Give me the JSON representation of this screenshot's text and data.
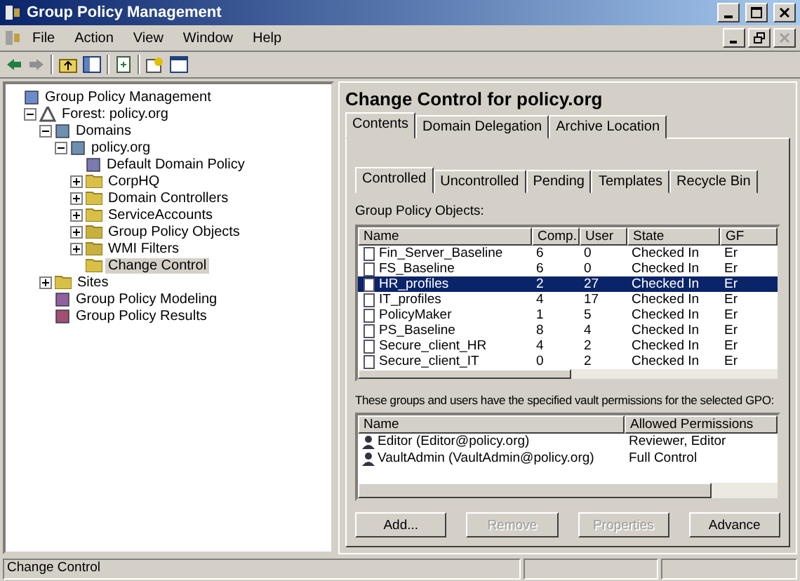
{
  "window": {
    "title": "Group Policy Management"
  },
  "menu": [
    "File",
    "Action",
    "View",
    "Window",
    "Help"
  ],
  "tree": [
    {
      "label": "Group Policy Management",
      "kind": "console",
      "selected": false,
      "children": [
        {
          "label": "Forest: policy.org",
          "kind": "forest",
          "expanded": true,
          "selected": false,
          "children": [
            {
              "label": "Domains",
              "kind": "domains",
              "expanded": true,
              "selected": false,
              "children": [
                {
                  "label": "policy.org",
                  "kind": "domain",
                  "expanded": true,
                  "selected": false,
                  "children": [
                    {
                      "label": "Default Domain Policy",
                      "kind": "gpo",
                      "selected": false
                    },
                    {
                      "label": "CorpHQ",
                      "kind": "ou",
                      "expanded": false,
                      "selected": false
                    },
                    {
                      "label": "Domain Controllers",
                      "kind": "ou",
                      "expanded": false,
                      "selected": false
                    },
                    {
                      "label": "ServiceAccounts",
                      "kind": "ou",
                      "expanded": false,
                      "selected": false
                    },
                    {
                      "label": "Group Policy Objects",
                      "kind": "container",
                      "expanded": false,
                      "selected": false
                    },
                    {
                      "label": "WMI Filters",
                      "kind": "container",
                      "expanded": false,
                      "selected": false
                    },
                    {
                      "label": "Change Control",
                      "kind": "ou",
                      "selected": true
                    }
                  ]
                }
              ]
            },
            {
              "label": "Sites",
              "kind": "ou",
              "expanded": false,
              "selected": false
            },
            {
              "label": "Group Policy Modeling",
              "kind": "modeling",
              "selected": false
            },
            {
              "label": "Group Policy Results",
              "kind": "results",
              "selected": false
            }
          ]
        }
      ]
    }
  ],
  "panel": {
    "title": "Change Control for policy.org",
    "tabs": [
      {
        "label": "Contents",
        "selected": true
      },
      {
        "label": "Domain Delegation",
        "selected": false
      },
      {
        "label": "Archive Location",
        "selected": false
      }
    ],
    "subtabs": [
      {
        "label": "Controlled",
        "selected": true
      },
      {
        "label": "Uncontrolled",
        "selected": false
      },
      {
        "label": "Pending",
        "selected": false
      },
      {
        "label": "Templates",
        "selected": false
      },
      {
        "label": "Recycle Bin",
        "selected": false
      }
    ],
    "gpo_label": "Group Policy Objects:",
    "gpo_table": {
      "columns": [
        "Name",
        "Comp.",
        "User",
        "State",
        "GF"
      ],
      "rows": [
        {
          "cells": [
            "Fin_Server_Baseline",
            "6",
            "0",
            "Checked In",
            "Er"
          ],
          "selected": false
        },
        {
          "cells": [
            "FS_Baseline",
            "6",
            "0",
            "Checked In",
            "Er"
          ],
          "selected": false
        },
        {
          "cells": [
            "HR_profiles",
            "2",
            "27",
            "Checked In",
            "Er"
          ],
          "selected": true
        },
        {
          "cells": [
            "IT_profiles",
            "4",
            "17",
            "Checked In",
            "Er"
          ],
          "selected": false
        },
        {
          "cells": [
            "PolicyMaker",
            "1",
            "5",
            "Checked In",
            "Er"
          ],
          "selected": false
        },
        {
          "cells": [
            "PS_Baseline",
            "8",
            "4",
            "Checked In",
            "Er"
          ],
          "selected": false
        },
        {
          "cells": [
            "Secure_client_HR",
            "4",
            "2",
            "Checked In",
            "Er"
          ],
          "selected": false
        },
        {
          "cells": [
            "Secure_client_IT",
            "0",
            "2",
            "Checked In",
            "Er"
          ],
          "selected": false
        }
      ]
    },
    "perm_label": "These groups and users have the specified vault permissions for the selected GPO:",
    "perm_table": {
      "columns": [
        "Name",
        "Allowed Permissions"
      ],
      "rows": [
        {
          "cells": [
            "Editor (Editor@policy.org)",
            "Reviewer, Editor"
          ]
        },
        {
          "cells": [
            "VaultAdmin (VaultAdmin@policy.org)",
            "Full Control"
          ]
        }
      ]
    },
    "buttons": [
      {
        "label": "Add...",
        "disabled": false
      },
      {
        "label": "Remove",
        "disabled": true
      },
      {
        "label": "Properties",
        "disabled": true
      },
      {
        "label": "Advance",
        "disabled": false
      }
    ]
  },
  "status_bar": [
    "Change Control"
  ]
}
